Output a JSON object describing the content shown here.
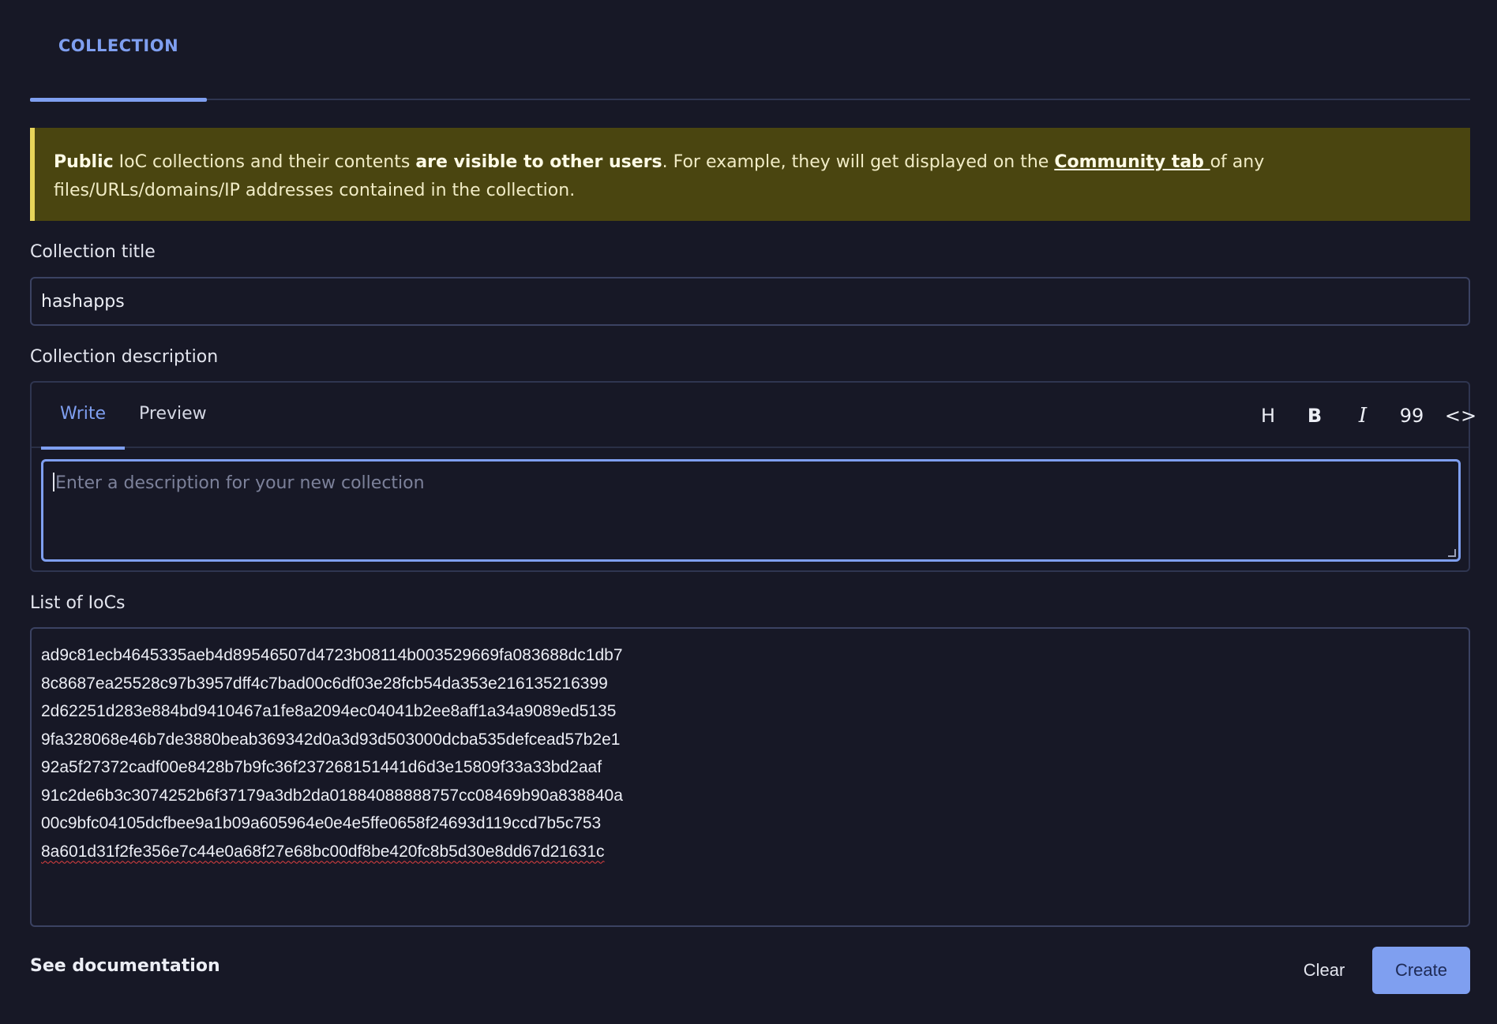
{
  "top_tabs": [
    {
      "label": "COLLECTION"
    }
  ],
  "banner": {
    "part1_bold": "Public",
    "part2": " IoC collections and their contents ",
    "part3_bold": "are visible to other users",
    "part4": ". For example, they will get displayed on the ",
    "link": "Community tab ",
    "part5": "of any files/URLs/domains/IP addresses contained in the collection."
  },
  "title_field": {
    "label": "Collection title",
    "value": "hashapps"
  },
  "description": {
    "label": "Collection description",
    "tabs": [
      "Write",
      "Preview"
    ],
    "toolbar": {
      "heading": "H",
      "bold": "B",
      "italic": "I",
      "quote": "99",
      "code": "<>"
    },
    "placeholder": "Enter a description for your new collection"
  },
  "ioc_list": {
    "label": "List of IoCs",
    "items": [
      "ad9c81ecb4645335aeb4d89546507d4723b08114b003529669fa083688dc1db7",
      "8c8687ea25528c97b3957dff4c7bad00c6df03e28fcb54da353e216135216399",
      "2d62251d283e884bd9410467a1fe8a2094ec04041b2ee8aff1a34a9089ed5135",
      "9fa328068e46b7de3880beab369342d0a3d93d503000dcba535defcead57b2e1",
      "92a5f27372cadf00e8428b7b9fc36f237268151441d6d3e15809f33a33bd2aaf",
      "91c2de6b3c3074252b6f37179a3db2da01884088888757cc08469b90a838840a",
      "00c9bfc04105dcfbee9a1b09a605964e0e4e5ffe0658f24693d119ccd7b5c753",
      "8a601d31f2fe356e7c44e0a68f27e68bc00df8be420fc8b5d30e8dd67d21631c"
    ]
  },
  "footer": {
    "doc_link": "See documentation",
    "clear": "Clear",
    "create": "Create"
  },
  "colors": {
    "accent": "#7f9ff0",
    "warning_bg": "#4a4510",
    "warning_border": "#e7d45a",
    "page_bg": "#171826"
  }
}
